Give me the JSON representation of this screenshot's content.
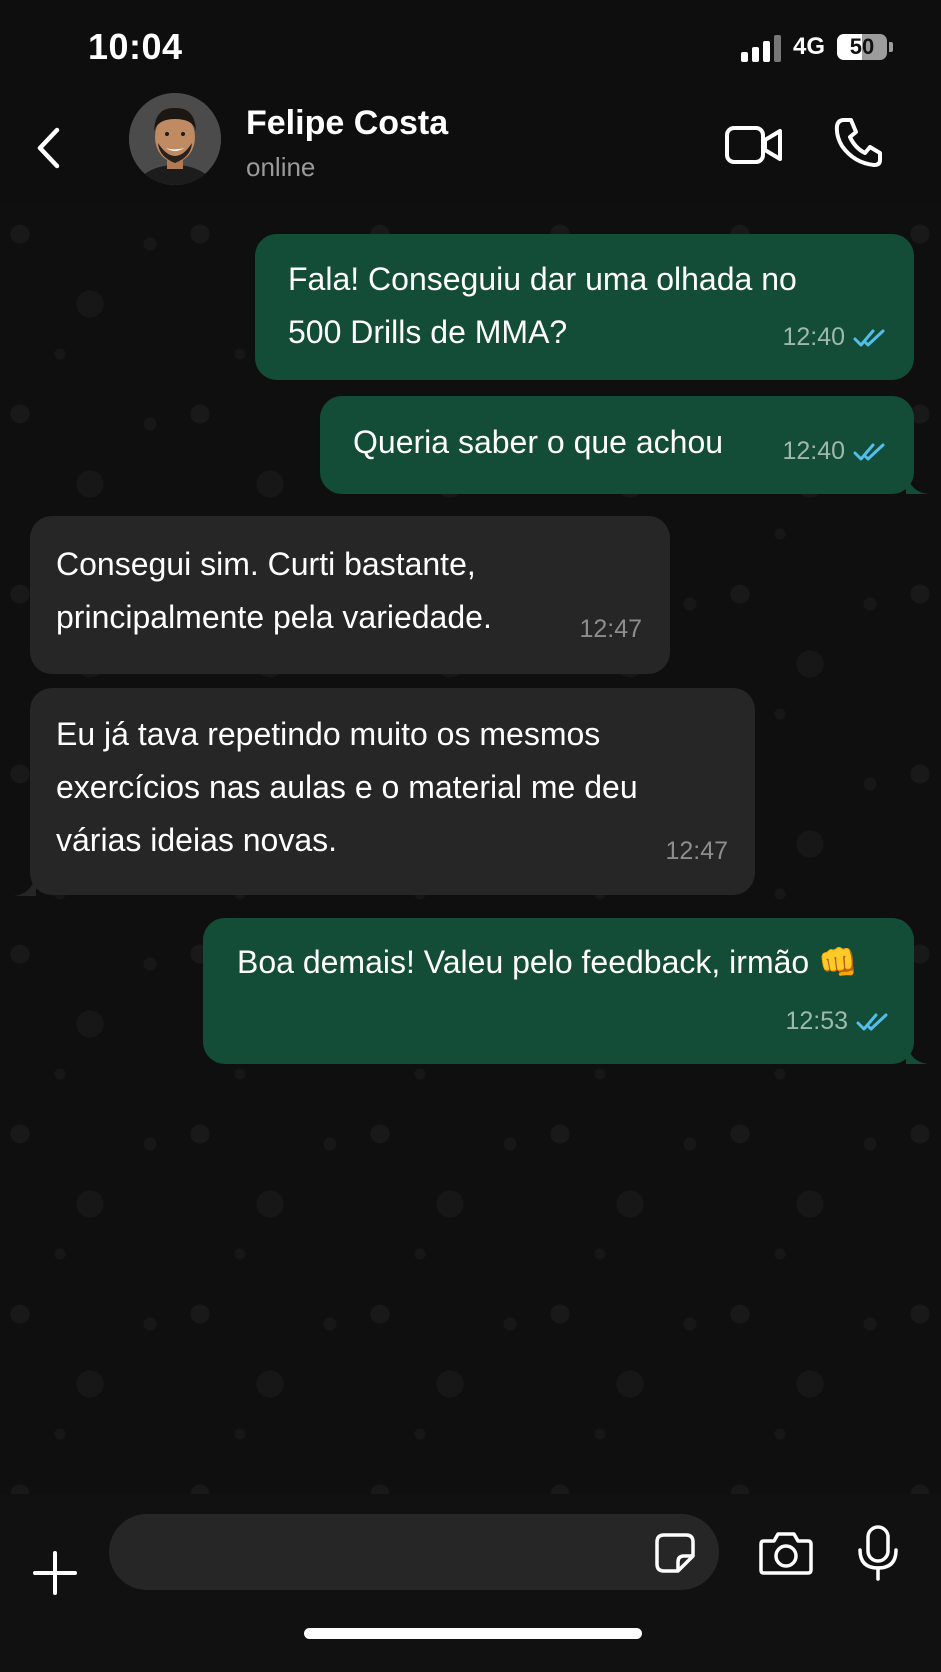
{
  "status_bar": {
    "time": "10:04",
    "network": "4G",
    "battery_level": "50"
  },
  "header": {
    "contact_name": "Felipe Costa",
    "contact_status": "online"
  },
  "messages": [
    {
      "direction": "out",
      "text": "Fala! Conseguiu dar uma olhada no\n500 Drills de MMA?",
      "time": "12:40",
      "read": true
    },
    {
      "direction": "out",
      "text": "Queria saber o que achou",
      "time": "12:40",
      "read": true
    },
    {
      "direction": "in",
      "text": "Consegui sim. Curti bastante,\nprincipalmente pela variedade.",
      "time": "12:47"
    },
    {
      "direction": "in",
      "text": "Eu já tava repetindo muito os mesmos\nexercícios nas aulas e o material me deu\nvárias ideias novas.",
      "time": "12:47"
    },
    {
      "direction": "out",
      "text": "Boa demais! Valeu pelo feedback, irmão 👊",
      "time": "12:53",
      "read": true
    }
  ],
  "input": {
    "placeholder": ""
  },
  "colors": {
    "outgoing_bubble": "#144d37",
    "incoming_bubble": "#262626",
    "read_ticks": "#53bdeb"
  }
}
